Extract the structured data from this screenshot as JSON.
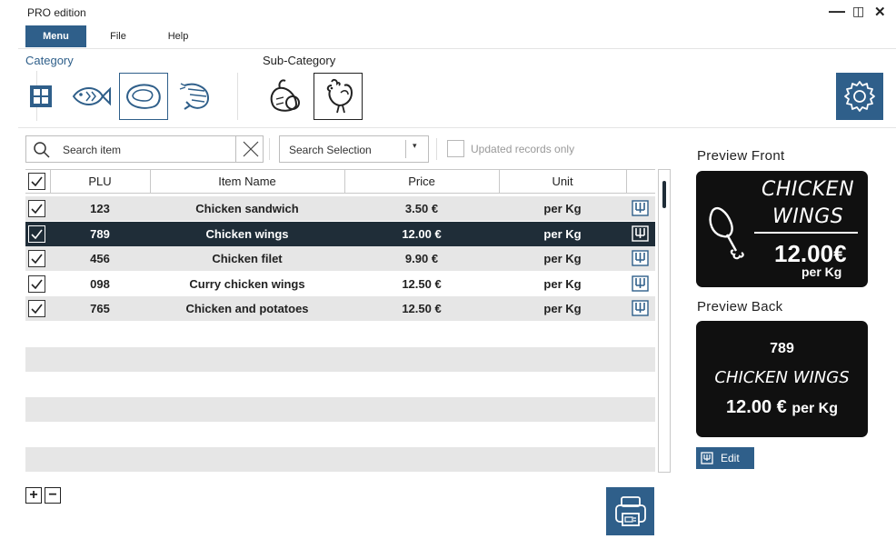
{
  "app": {
    "title": "PRO edition"
  },
  "window_controls": {
    "minimize": "—",
    "maximize": "◫",
    "close": "✕"
  },
  "menu": {
    "items": [
      "Menu",
      "File",
      "Help"
    ],
    "active": "Menu"
  },
  "categories": {
    "label": "Category",
    "icons": [
      "grid-icon",
      "fish-icon",
      "meat-icon",
      "shrimp-icon"
    ],
    "selected": "meat-icon"
  },
  "subcategories": {
    "label": "Sub-Category",
    "icons": [
      "poultry-icon",
      "rooster-icon"
    ],
    "selected": "rooster-icon"
  },
  "search": {
    "placeholder": "Search item",
    "selection_label": "Search Selection",
    "updated_only_label": "Updated records only"
  },
  "table": {
    "headers": [
      "PLU",
      "Item Name",
      "Price",
      "Unit"
    ],
    "rows": [
      {
        "plu": "123",
        "name": "Chicken sandwich",
        "price": "3.50 €",
        "unit": "per Kg",
        "checked": true,
        "selected": false
      },
      {
        "plu": "789",
        "name": "Chicken wings",
        "price": "12.00 €",
        "unit": "per Kg",
        "checked": true,
        "selected": true
      },
      {
        "plu": "456",
        "name": "Chicken filet",
        "price": "9.90 €",
        "unit": "per Kg",
        "checked": true,
        "selected": false
      },
      {
        "plu": "098",
        "name": "Curry chicken wings",
        "price": "12.50 €",
        "unit": "per Kg",
        "checked": true,
        "selected": false
      },
      {
        "plu": "765",
        "name": "Chicken and potatoes",
        "price": "12.50 €",
        "unit": "per Kg",
        "checked": true,
        "selected": false
      }
    ]
  },
  "buttons": {
    "add": "+",
    "remove": "−",
    "edit": "Edit"
  },
  "preview_front": {
    "label": "Preview Front",
    "line1": "CHICKEN",
    "line2": "WINGS",
    "price": "12.00€",
    "unit": "per Kg"
  },
  "preview_back": {
    "label": "Preview Back",
    "plu": "789",
    "name": "CHICKEN WINGS",
    "price": "12.00 €",
    "unit": "per Kg"
  },
  "colors": {
    "accent": "#2f5f8a",
    "selected_row": "#1f2d38",
    "row_gray": "#e6e6e6",
    "label_bg": "#101010"
  }
}
